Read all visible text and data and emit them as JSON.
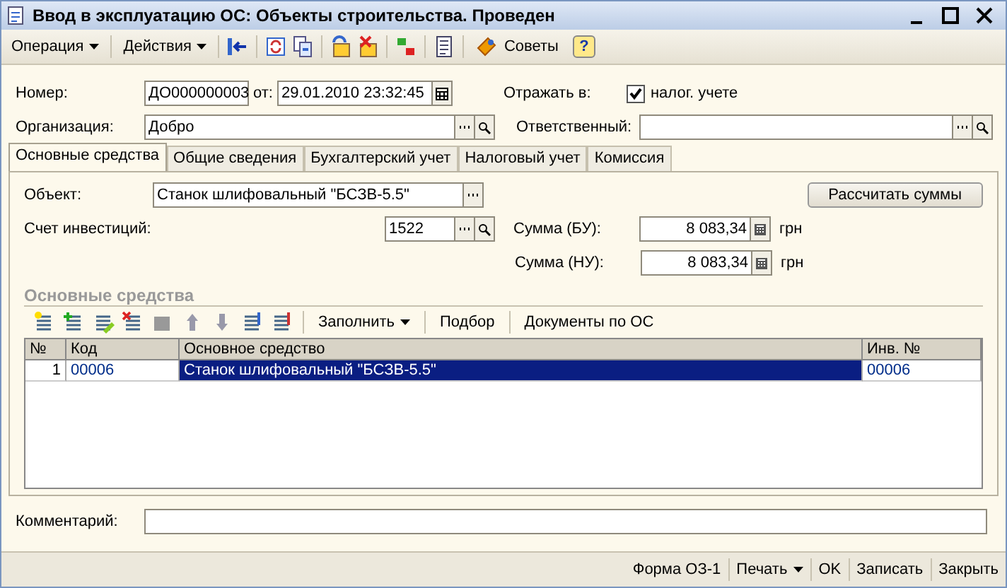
{
  "window": {
    "title": "Ввод в эксплуатацию ОС: Объекты строительства. Проведен"
  },
  "toolbar": {
    "menus": [
      {
        "label": "Операция",
        "dropdown": true
      },
      {
        "label": "Действия",
        "dropdown": true
      }
    ],
    "advice": "Советы",
    "help": "?"
  },
  "header": {
    "number_label": "Номер:",
    "number": "ДО000000003",
    "date_label": "от:",
    "date": "29.01.2010 23:32:45",
    "reflect_label": "Отражать в:",
    "tax": {
      "label": "налог. учете",
      "checked": true
    },
    "org_label": "Организация:",
    "org": "Добро",
    "resp_label": "Ответственный:"
  },
  "tabs": [
    {
      "label": "Основные средства",
      "selected": true
    },
    {
      "label": "Общие сведения",
      "selected": false
    },
    {
      "label": "Бухгалтерский учет",
      "selected": false
    },
    {
      "label": "Налоговый учет",
      "selected": false
    },
    {
      "label": "Комиссия",
      "selected": false
    }
  ],
  "panel": {
    "object_label": "Объект:",
    "object": "Станок шлифовальный \"БСЗВ-5.5\"",
    "calc_button": "Рассчитать суммы",
    "account_label": "Счет инвестиций:",
    "account": "1522",
    "sum_bu_label": "Сумма (БУ):",
    "sum_bu": "8 083,34",
    "sum_nu_label": "Сумма (НУ):",
    "sum_nu": "8 083,34",
    "currency_bu": "грн",
    "currency_nu": "грн",
    "section_title": "Основные средства",
    "table_actions": [
      {
        "label": "Заполнить",
        "dropdown": true
      },
      {
        "label": "Подбор",
        "dropdown": false
      },
      {
        "label": "Документы по ОС",
        "dropdown": false
      }
    ]
  },
  "table": {
    "columns": [
      "№",
      "Код",
      "Основное средство",
      "Инв. №"
    ],
    "rows": [
      {
        "cells": [
          "1",
          "00006",
          "Станок шлифовальный \"БСЗВ-5.5\"",
          "00006"
        ],
        "selected": true
      }
    ]
  },
  "comment_label": "Комментарий:",
  "footer": [
    {
      "label": "Форма ОЗ-1",
      "dropdown": false
    },
    {
      "label": "Печать",
      "dropdown": true
    },
    {
      "label": "OK",
      "dropdown": false
    },
    {
      "label": "Записать",
      "dropdown": false
    },
    {
      "label": "Закрыть",
      "dropdown": false
    }
  ]
}
